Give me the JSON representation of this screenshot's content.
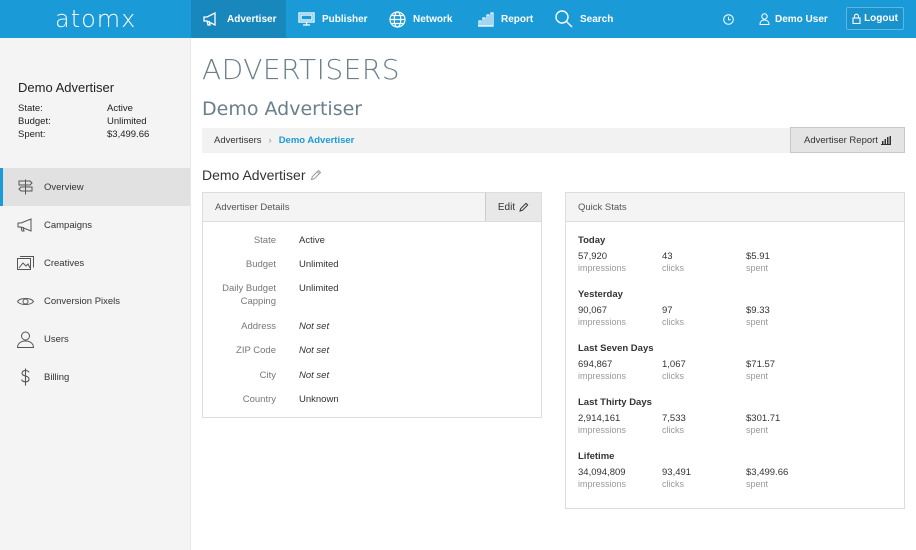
{
  "app": {
    "logo": "atomx"
  },
  "nav": {
    "advertiser": "Advertiser",
    "publisher": "Publisher",
    "network": "Network",
    "report": "Report",
    "search": "Search",
    "user": "Demo User",
    "logout": "Logout"
  },
  "sidebar": {
    "title": "Demo Advertiser",
    "info": [
      {
        "label": "State:",
        "value": "Active"
      },
      {
        "label": "Budget:",
        "value": "Unlimited"
      },
      {
        "label": "Spent:",
        "value": "$3,499.66"
      }
    ],
    "items": [
      {
        "label": "Overview",
        "icon": "signpost-icon"
      },
      {
        "label": "Campaigns",
        "icon": "megaphone-icon"
      },
      {
        "label": "Creatives",
        "icon": "image-icon"
      },
      {
        "label": "Conversion Pixels",
        "icon": "eye-icon"
      },
      {
        "label": "Users",
        "icon": "user-icon"
      },
      {
        "label": "Billing",
        "icon": "dollar-icon"
      }
    ]
  },
  "main": {
    "title": "ADVERTISERS",
    "subtitle": "Demo Advertiser",
    "breadcrumb": [
      "Advertisers",
      "Demo Advertiser"
    ],
    "report_button": "Advertiser Report",
    "heading": "Demo Advertiser"
  },
  "details": {
    "title": "Advertiser Details",
    "edit": "Edit",
    "rows": [
      {
        "k": "State",
        "v": "Active"
      },
      {
        "k": "Budget",
        "v": "Unlimited"
      },
      {
        "k": "Daily Budget Capping",
        "v": "Unlimited"
      },
      {
        "k": "Address",
        "v": "Not set"
      },
      {
        "k": "ZIP Code",
        "v": "Not set"
      },
      {
        "k": "City",
        "v": "Not set"
      },
      {
        "k": "Country",
        "v": "Unknown"
      }
    ]
  },
  "stats": {
    "title": "Quick Stats",
    "labels": {
      "impressions": "impressions",
      "clicks": "clicks",
      "spent": "spent"
    },
    "groups": [
      {
        "name": "Today",
        "impressions": "57,920",
        "clicks": "43",
        "spent": "$5.91"
      },
      {
        "name": "Yesterday",
        "impressions": "90,067",
        "clicks": "97",
        "spent": "$9.33"
      },
      {
        "name": "Last Seven Days",
        "impressions": "694,867",
        "clicks": "1,067",
        "spent": "$71.57"
      },
      {
        "name": "Last Thirty Days",
        "impressions": "2,914,161",
        "clicks": "7,533",
        "spent": "$301.71"
      },
      {
        "name": "Lifetime",
        "impressions": "34,094,809",
        "clicks": "93,491",
        "spent": "$3,499.66"
      }
    ]
  },
  "colors": {
    "brand": "#1a9bd7",
    "title": "#6b7f8a"
  }
}
